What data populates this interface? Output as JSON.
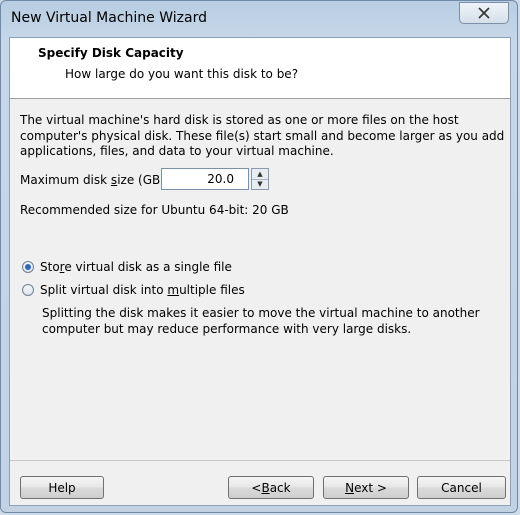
{
  "window": {
    "title": "New Virtual Machine Wizard",
    "close_icon": "close-icon"
  },
  "header": {
    "title": "Specify Disk Capacity",
    "subtitle": "How large do you want this disk to be?"
  },
  "description": "The virtual machine's hard disk is stored as one or more files on the host computer's physical disk. These file(s) start small and become larger as you add applications, files, and data to your virtual machine.",
  "disk_size": {
    "label_pre": "Maximum disk ",
    "label_underlined": "s",
    "label_post": "ize (GB):",
    "value": "20.0"
  },
  "recommendation": "Recommended size for Ubuntu 64-bit: 20 GB",
  "options": {
    "single": {
      "pre": "Sto",
      "u": "r",
      "post": "e virtual disk as a single file",
      "selected": true
    },
    "split": {
      "pre": "Split virtual disk into ",
      "u": "m",
      "post": "ultiple files",
      "selected": false
    }
  },
  "split_note": "Splitting the disk makes it easier to move the virtual machine to another computer but may reduce performance with very large disks.",
  "buttons": {
    "help": "Help",
    "back_pre": "< ",
    "back_u": "B",
    "back_post": "ack",
    "next_u": "N",
    "next_post": "ext >",
    "cancel": "Cancel"
  }
}
